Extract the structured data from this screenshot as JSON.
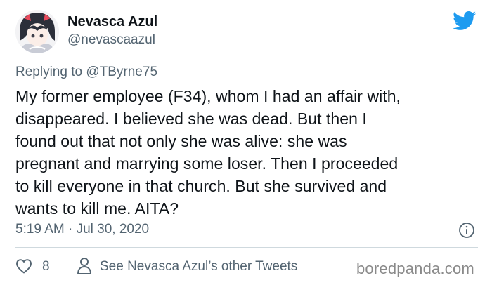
{
  "author": {
    "display_name": "Nevasca Azul",
    "handle": "@nevascaazul"
  },
  "reply": {
    "prefix": "Replying to",
    "mention": "@TByrne75"
  },
  "tweet": {
    "lines": [
      "My former employee (F34), whom I had an affair with,",
      "disappeared. I believed she was dead. But then I",
      "found out that not only she was alive: she was",
      "pregnant and marrying some loser. Then I proceeded",
      "to kill everyone in that church. But she survived and",
      "wants to kill me. AITA?"
    ],
    "timestamp": "5:19 AM · Jul 30, 2020"
  },
  "actions": {
    "like_count": "8",
    "other_tweets_label": "See Nevasca Azul’s other Tweets"
  },
  "watermark": "boredpanda.com",
  "icons": {
    "brand": "twitter-bird-icon",
    "info": "info-icon",
    "like": "heart-icon",
    "profile": "user-icon"
  },
  "colors": {
    "twitter_blue": "#1d9bf0",
    "secondary_text": "#536471",
    "divider": "#cfd9de"
  }
}
